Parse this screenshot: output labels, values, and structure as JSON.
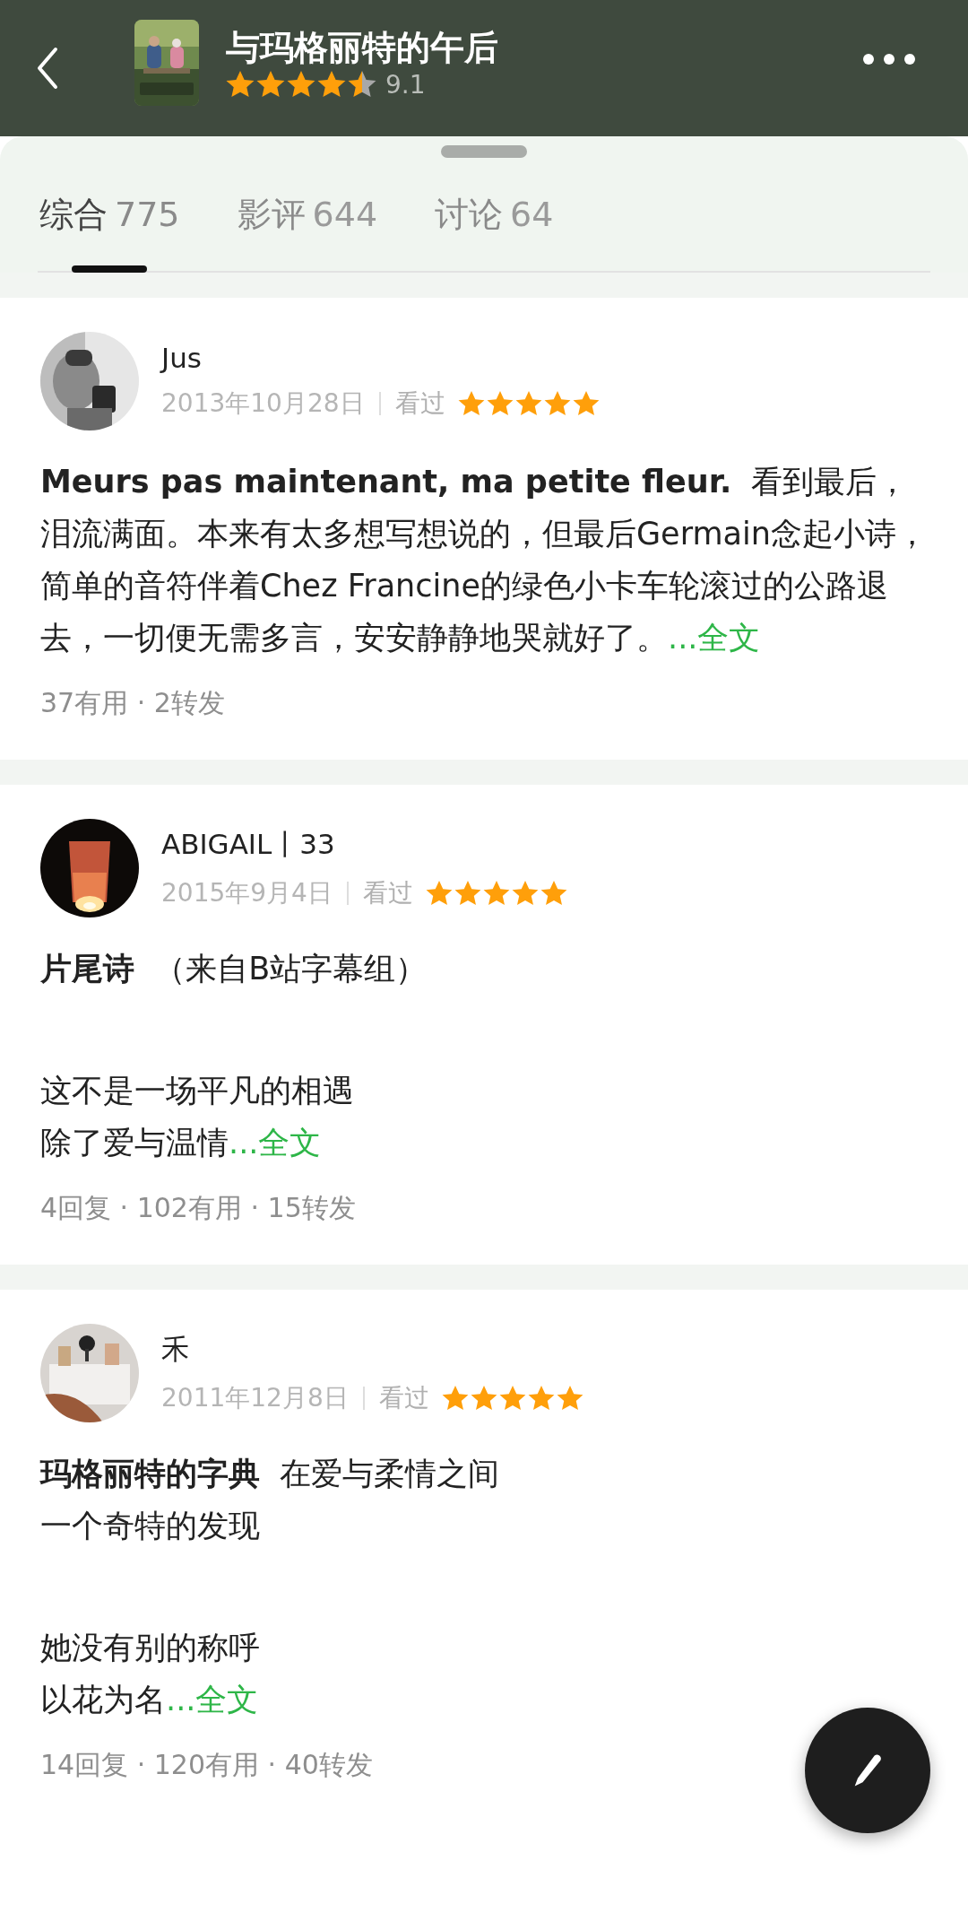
{
  "header": {
    "title": "与玛格丽特的午后",
    "stars": 4.5,
    "score": "9.1",
    "poster": {
      "kind": "picture"
    }
  },
  "tabs": [
    {
      "label": "综合",
      "count": "775",
      "selected": true
    },
    {
      "label": "影评",
      "count": "644",
      "selected": false
    },
    {
      "label": "讨论",
      "count": "64",
      "selected": false
    }
  ],
  "reviews": [
    {
      "user": "Jus",
      "date": "2013年10月28日",
      "status": "看过",
      "stars": 5,
      "avatar": {
        "kind": "picture"
      },
      "blocks": [
        {
          "lines": [
            "**Meurs pas maintenant, ma petite fleur.**  看到最后，泪流满面。本来有太多想写想说的，但最后Germain念起小诗，简单的音符伴着Chez Francine的绿色小卡车轮滚过的公路退去，一切便无需多言，安安静静地哭就好了。"
          ]
        }
      ],
      "more": "...全文",
      "stats": "37有用 · 2转发"
    },
    {
      "user": "ABIGAIL丨33",
      "date": "2015年9月4日",
      "status": "看过",
      "stars": 5,
      "avatar": {
        "kind": "picture"
      },
      "blocks": [
        {
          "lines": [
            "**片尾诗**  （来自B站字幕组）"
          ]
        },
        {
          "lines": [
            "这不是一场平凡的相遇",
            "除了爱与温情"
          ]
        }
      ],
      "more": "...全文",
      "stats": "4回复 · 102有用 · 15转发"
    },
    {
      "user": "禾",
      "date": "2011年12月8日",
      "status": "看过",
      "stars": 5,
      "avatar": {
        "kind": "picture"
      },
      "blocks": [
        {
          "lines": [
            "**玛格丽特的字典**  在爱与柔情之间",
            "一个奇特的发现"
          ]
        },
        {
          "lines": [
            "她没有别的称呼",
            "以花为名"
          ]
        }
      ],
      "more": "...全文",
      "stats": "14回复 · 120有用 · 40转发"
    }
  ]
}
